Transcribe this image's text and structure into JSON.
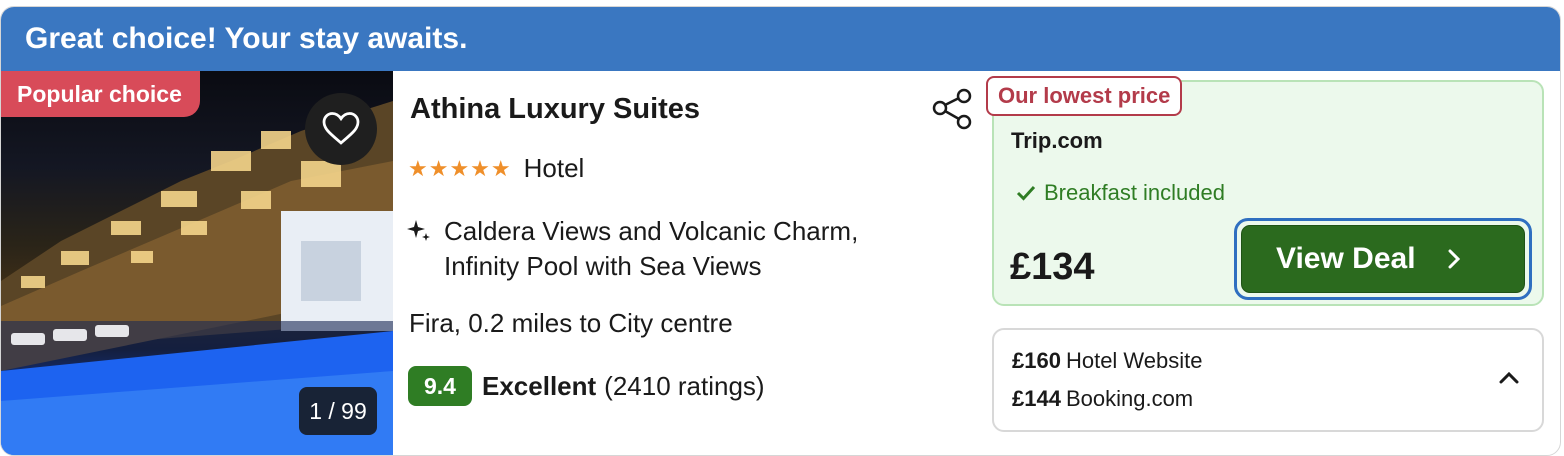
{
  "banner": {
    "text": "Great choice! Your stay awaits."
  },
  "photo": {
    "badge": "Popular choice",
    "counter": "1 / 99",
    "favorite_icon": "heart-outline-icon"
  },
  "hotel": {
    "name": "Athina Luxury Suites",
    "stars": 5,
    "stars_text": "★★★★★",
    "type": "Hotel",
    "highlights": [
      "Caldera Views and Volcanic Charm,",
      "Infinity Pool with Sea Views"
    ],
    "location": "Fira, 0.2 miles to City centre",
    "score": "9.4",
    "rating_word": "Excellent",
    "rating_count": "(2410 ratings)"
  },
  "deal": {
    "tag": "Our lowest price",
    "provider": "Trip.com",
    "perk": "Breakfast included",
    "price": "£134",
    "button_label": "View Deal"
  },
  "other_prices": [
    {
      "price": "£160",
      "provider": "Hotel Website"
    },
    {
      "price": "£144",
      "provider": "Booking.com"
    }
  ],
  "colors": {
    "banner": "#3a77c1",
    "popular_badge": "#d84b59",
    "stars": "#ef8f2a",
    "score_badge": "#2f7d24",
    "deal_bg": "#ecf9ec",
    "lowest_tag": "#b33b4a",
    "view_deal_button": "#2b6a1e"
  }
}
